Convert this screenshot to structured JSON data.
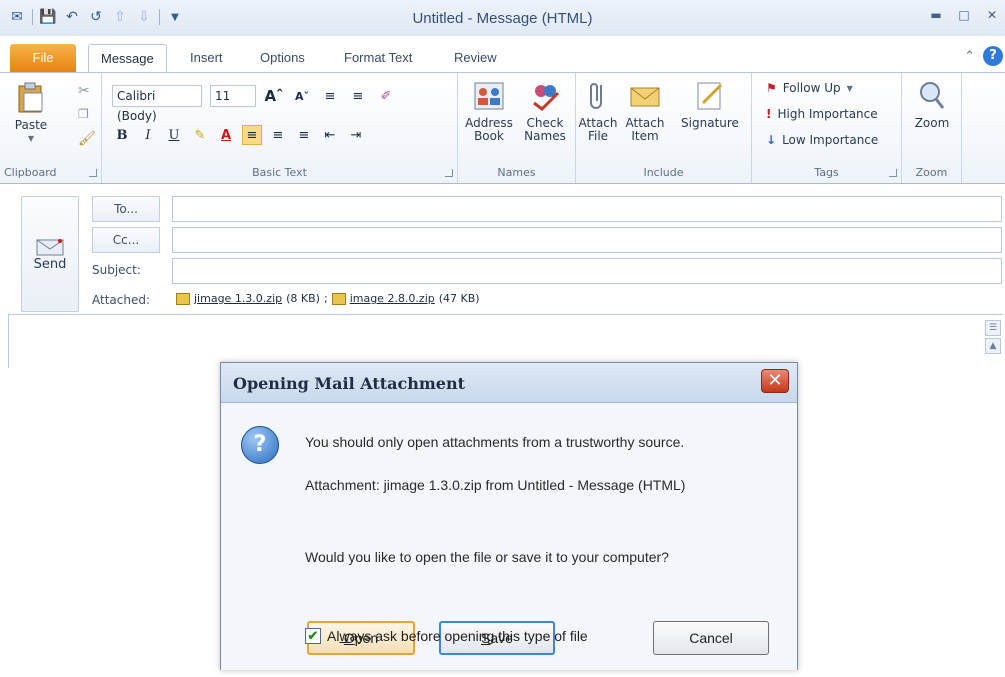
{
  "window": {
    "title": "Untitled - Message (HTML)"
  },
  "ribbon_tabs": {
    "file": "File",
    "message": "Message",
    "insert": "Insert",
    "options": "Options",
    "format_text": "Format Text",
    "review": "Review"
  },
  "ribbon": {
    "clipboard": {
      "paste": "Paste",
      "label": "Clipboard"
    },
    "basic_text": {
      "font_name": "Calibri (Body)",
      "font_size": "11",
      "label": "Basic Text"
    },
    "names": {
      "address_book": "Address Book",
      "check_names": "Check Names",
      "label": "Names"
    },
    "include": {
      "attach_file": "Attach File",
      "attach_item": "Attach Item",
      "signature": "Signature",
      "label": "Include"
    },
    "tags": {
      "follow_up": "Follow Up",
      "high_importance": "High Importance",
      "low_importance": "Low Importance",
      "label": "Tags"
    },
    "zoom": {
      "zoom": "Zoom",
      "label": "Zoom"
    }
  },
  "compose": {
    "send": "Send",
    "to": "To...",
    "cc": "Cc...",
    "subject_label": "Subject:",
    "attached_label": "Attached:",
    "attachments": [
      {
        "name": "jimage 1.3.0.zip",
        "size": "(8 KB)"
      },
      {
        "name": "image 2.8.0.zip",
        "size": "(47 KB)"
      }
    ]
  },
  "dialog": {
    "title": "Opening Mail Attachment",
    "message": "You should only open attachments from a trustworthy source.",
    "attachment_line": "Attachment: jimage 1.3.0.zip from Untitled - Message (HTML)",
    "question": "Would you like to open the file or save it to your computer?",
    "open_u": "O",
    "open_rest": "pen",
    "save_u": "S",
    "save_rest": "ave",
    "cancel": "Cancel",
    "checkbox_before": "Al",
    "checkbox_u": "w",
    "checkbox_after": "ays ask before opening this type of file",
    "checkbox_checked": true
  }
}
